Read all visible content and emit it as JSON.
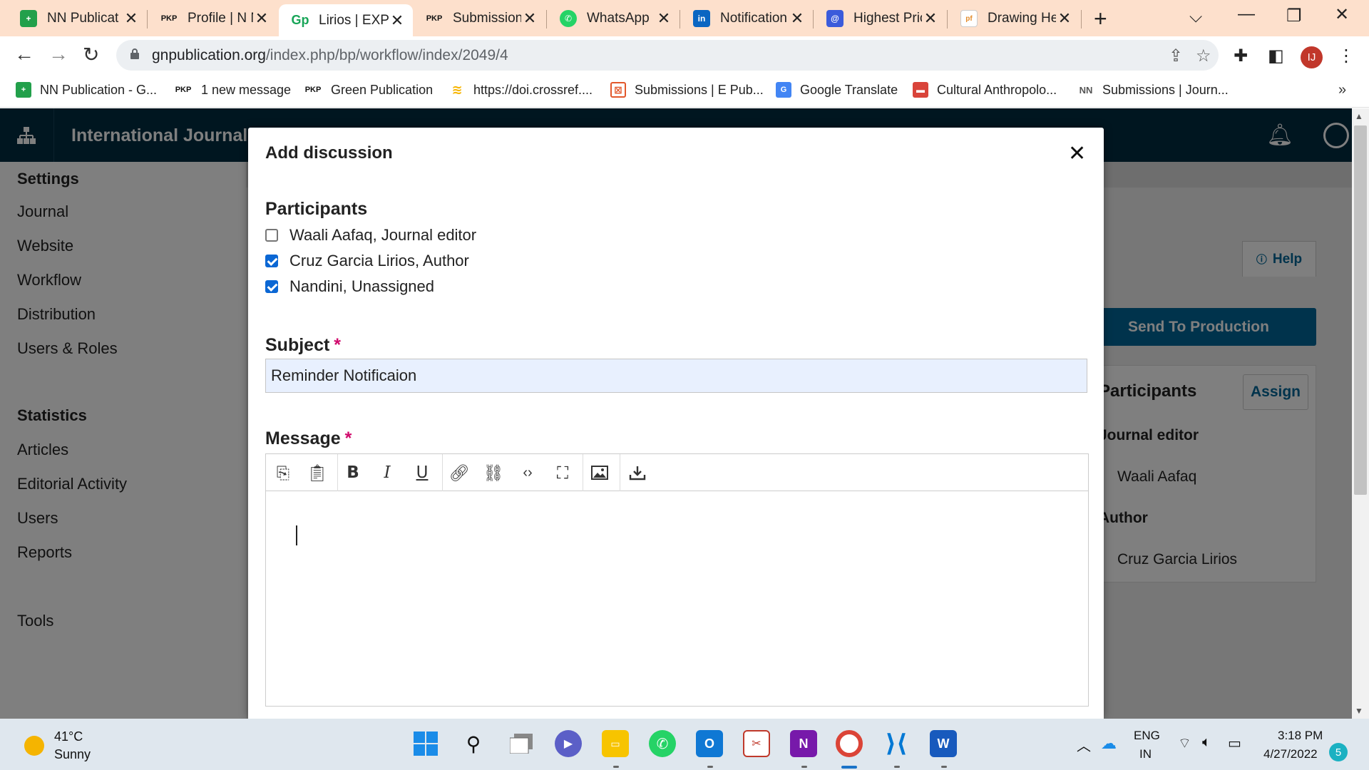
{
  "browser": {
    "tabs": [
      {
        "title": "NN Publicat",
        "favicon": "nn-publication-icon",
        "favcolor": "#22a04b",
        "favtext": "+"
      },
      {
        "title": "Profile | N N",
        "favicon": "pkp-icon",
        "favcolor": "#ffffff",
        "favtext": "PKP"
      },
      {
        "title": "Lirios | EXPL",
        "favicon": "gp-icon",
        "favcolor": "#ffffff",
        "favtext": "Gp"
      },
      {
        "title": "Submission",
        "favicon": "pkp-icon",
        "favcolor": "#ffffff",
        "favtext": "PKP"
      },
      {
        "title": "WhatsApp",
        "favicon": "whatsapp-icon",
        "favcolor": "#25d366",
        "favtext": "✆"
      },
      {
        "title": "Notification",
        "favicon": "linkedin-icon",
        "favcolor": "#0a66c2",
        "favtext": "in"
      },
      {
        "title": "Highest Pric",
        "favicon": "at-sign-icon",
        "favcolor": "#3b5bdb",
        "favtext": "@"
      },
      {
        "title": "Drawing He",
        "favicon": "document-icon",
        "favcolor": "#ffffff",
        "favtext": "pf"
      }
    ],
    "url_domain": "gnpublication.org",
    "url_path": "/index.php/bp/workflow/index/2049/4",
    "profile_initials": "IJ",
    "bookmarks": [
      {
        "label": "NN Publication - G...",
        "icon": "nn-publication-icon",
        "color": "#22a04b",
        "text": "+"
      },
      {
        "label": "1 new message",
        "icon": "pkp-icon",
        "color": "#ffffff",
        "text": "PKP"
      },
      {
        "label": "Green Publication",
        "icon": "pkp-icon",
        "color": "#ffffff",
        "text": "PKP"
      },
      {
        "label": "https://doi.crossref....",
        "icon": "crossref-icon",
        "color": "#f7b500",
        "text": "≋"
      },
      {
        "label": "Submissions | E Pub...",
        "icon": "epub-icon",
        "color": "#e2572b",
        "text": "⊠"
      },
      {
        "label": "Google Translate",
        "icon": "google-translate-icon",
        "color": "#4285f4",
        "text": "G"
      },
      {
        "label": "Cultural Anthropolo...",
        "icon": "journal-icon",
        "color": "#d9443a",
        "text": "▬"
      },
      {
        "label": "Submissions | Journ...",
        "icon": "nn-logo-icon",
        "color": "#ffffff",
        "text": "NN"
      }
    ]
  },
  "ojs": {
    "site_title": "International Journal",
    "sidebar": {
      "settings_head": "Settings",
      "settings_items": [
        "Journal",
        "Website",
        "Workflow",
        "Distribution",
        "Users & Roles"
      ],
      "statistics_head": "Statistics",
      "statistics_items": [
        "Articles",
        "Editorial Activity",
        "Users",
        "Reports"
      ],
      "tools": "Tools"
    },
    "help_label": "Help",
    "send_to_production": "Send To Production",
    "participants_title": "Participants",
    "assign_label": "Assign",
    "participants": [
      {
        "role": "Journal editor",
        "name": "Waali Aafaq"
      },
      {
        "role": "Author",
        "name": "Cruz Garcia Lirios"
      }
    ]
  },
  "modal": {
    "title": "Add discussion",
    "participants_head": "Participants",
    "participants": [
      {
        "label": "Waali Aafaq, Journal editor",
        "checked": false
      },
      {
        "label": "Cruz Garcia Lirios, Author",
        "checked": true
      },
      {
        "label": "Nandini, Unassigned",
        "checked": true
      }
    ],
    "subject_label": "Subject",
    "subject_value": "Reminder Notificaion",
    "message_label": "Message",
    "required_mark": "*",
    "editor_tools": [
      "copy-icon",
      "paste-icon",
      "bold-icon",
      "italic-icon",
      "underline-icon",
      "link-icon",
      "unlink-icon",
      "code-icon",
      "fullscreen-icon",
      "image-icon",
      "upload-icon"
    ]
  },
  "taskbar": {
    "temperature": "41°C",
    "weather": "Sunny",
    "lang_top": "ENG",
    "lang_bottom": "IN",
    "time": "3:18 PM",
    "date": "4/27/2022",
    "notification_count": "5"
  }
}
